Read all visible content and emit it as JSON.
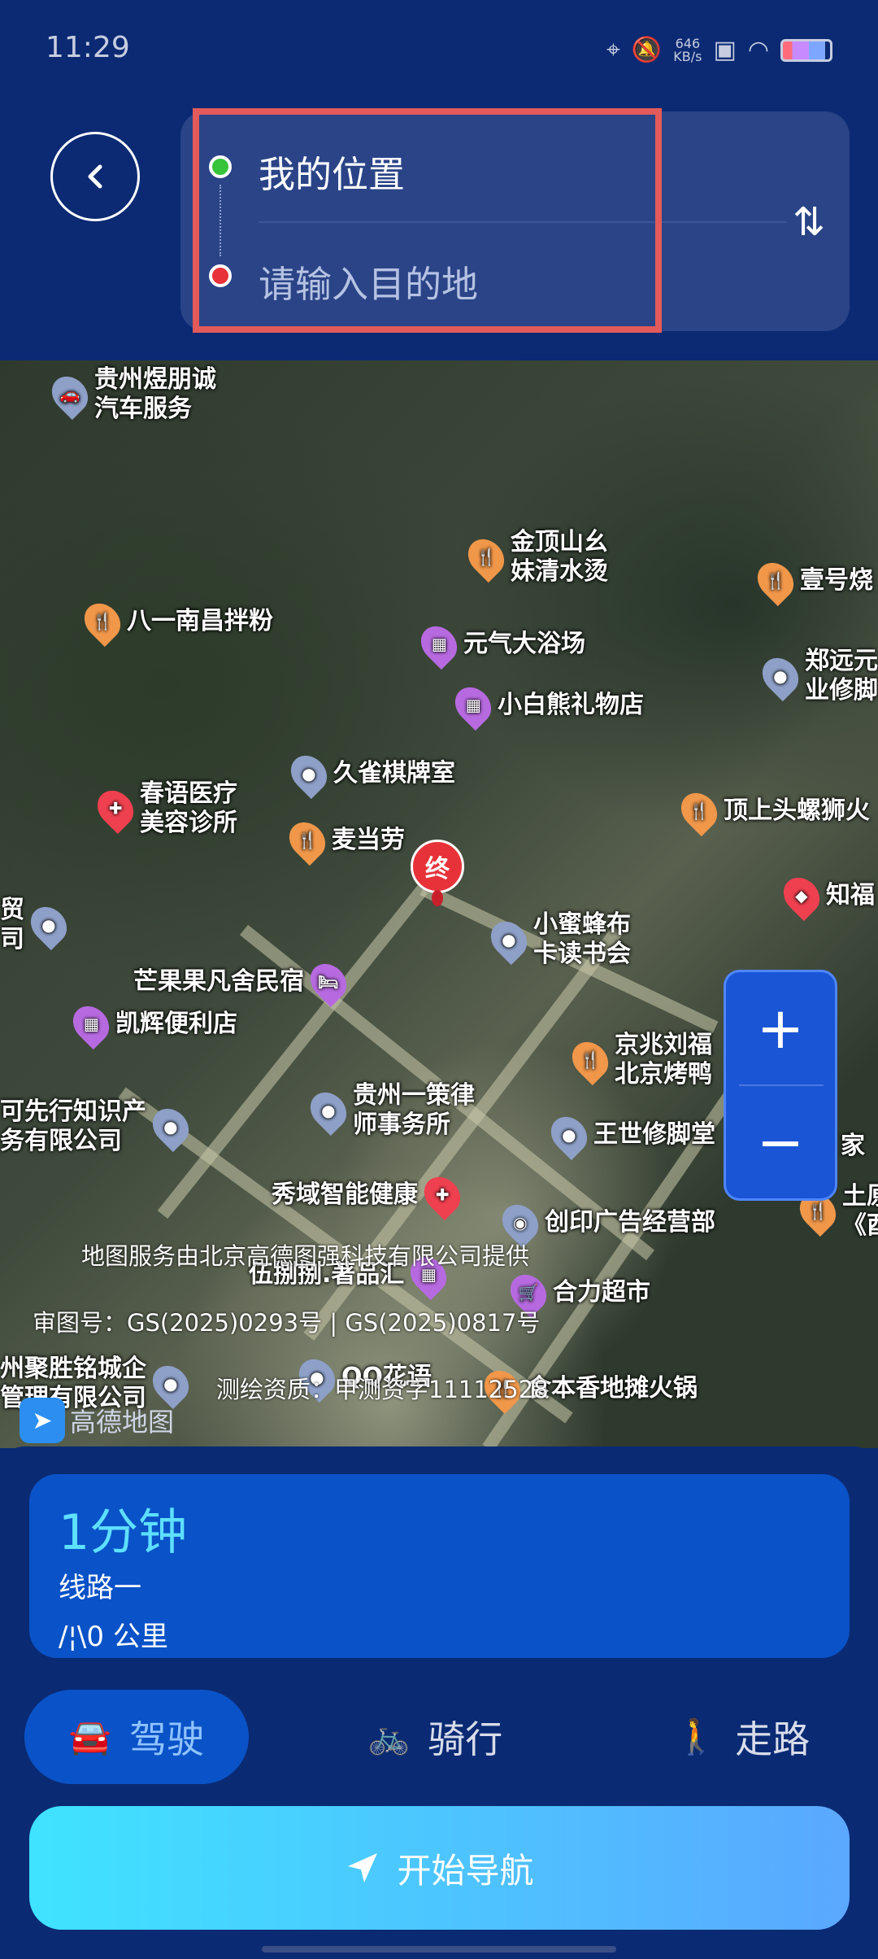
{
  "status_bar": {
    "time": "11:29",
    "net_speed": "646\nKB/s"
  },
  "header": {
    "origin": "我的位置",
    "destination_placeholder": "请输入目的地",
    "swap_icon": "swap-vertical-icon"
  },
  "map": {
    "end_marker": "终",
    "pois": [
      {
        "label": "贵州煜朋诚\n汽车服务",
        "icon": "car-icon"
      },
      {
        "label": "金顶山幺\n妹清水烫",
        "icon": "restaurant-icon"
      },
      {
        "label": "壹号烧",
        "icon": "restaurant-icon"
      },
      {
        "label": "八一南昌拌粉",
        "icon": "restaurant-icon"
      },
      {
        "label": "元气大浴场",
        "icon": "shop-icon"
      },
      {
        "label": "郑远元\n业修脚",
        "icon": "location-icon"
      },
      {
        "label": "小白熊礼物店",
        "icon": "shop-icon"
      },
      {
        "label": "久雀棋牌室",
        "icon": "location-icon"
      },
      {
        "label": "春语医疗\n美容诊所",
        "icon": "hospital-icon"
      },
      {
        "label": "顶上头螺狮火",
        "icon": "restaurant-icon"
      },
      {
        "label": "麦当劳",
        "icon": "restaurant-icon"
      },
      {
        "label": "贸\n司",
        "icon": "location-icon"
      },
      {
        "label": "知福",
        "icon": "tag-icon"
      },
      {
        "label": "小蜜蜂布\n卡读书会",
        "icon": "location-icon"
      },
      {
        "label": "芒果果凡舍民宿",
        "icon": "hotel-icon"
      },
      {
        "label": "凯辉便利店",
        "icon": "shop-icon"
      },
      {
        "label": "京兆刘福\n北京烤鸭",
        "icon": "restaurant-icon"
      },
      {
        "label": "可先行知识产\n务有限公司",
        "icon": "location-icon"
      },
      {
        "label": "贵州一策律\n师事务所",
        "icon": "location-icon"
      },
      {
        "label": "王世修脚堂",
        "icon": "location-icon"
      },
      {
        "label": "家",
        "icon": "location-icon"
      },
      {
        "label": "秀域智能健康",
        "icon": "hospital-icon"
      },
      {
        "label": "创印广告经营部",
        "icon": "camera-icon"
      },
      {
        "label": "土原\n《酉",
        "icon": "restaurant-icon"
      },
      {
        "label": "伍捌捌.著品汇",
        "icon": "shop-icon"
      },
      {
        "label": "合力超市",
        "icon": "cart-icon"
      },
      {
        "label": "州聚胜铭城企\n管理有限公司",
        "icon": "location-icon"
      },
      {
        "label": "QQ花语",
        "icon": "location-icon"
      },
      {
        "label": "食本香地摊火锅",
        "icon": "restaurant-icon"
      }
    ],
    "credit_line": "地图服务由北京高德图强科技有限公司提供",
    "approval_line": "审图号：GS(2025)0293号 | GS(2025)0817号",
    "survey_line": "测绘资质：甲测资字11112528",
    "logo_text": "高德地图"
  },
  "route": {
    "duration": "1分钟",
    "name": "线路一",
    "distance": "0 公里"
  },
  "modes": [
    {
      "label": "驾驶",
      "icon": "car-icon",
      "active": true
    },
    {
      "label": "骑行",
      "icon": "bike-icon",
      "active": false
    },
    {
      "label": "走路",
      "icon": "walk-icon",
      "active": false
    }
  ],
  "start_nav": "开始导航",
  "colors": {
    "header_bg": "#0b2a73",
    "card_bg": "#0a52c7",
    "duration": "#5ee0ff",
    "highlight": "#e35a5a"
  }
}
